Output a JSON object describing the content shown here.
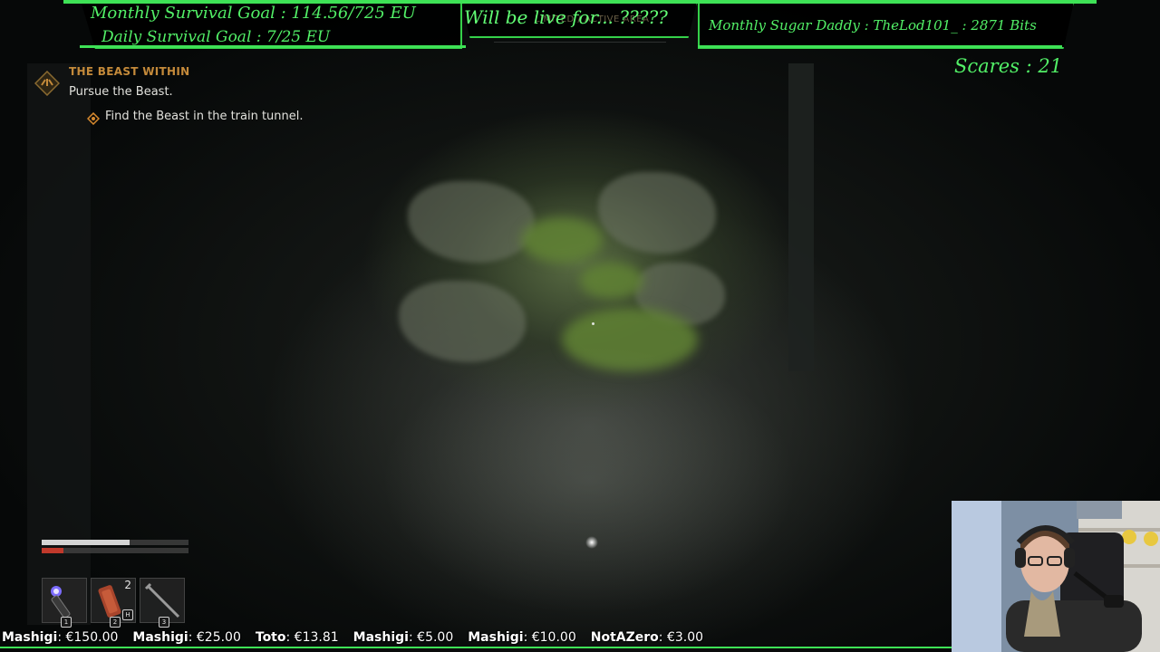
{
  "overlay": {
    "monthly_survival_goal": "Monthly Survival Goal : 114.56/725 EU",
    "daily_survival_goal": "Daily Survival Goal : 7/25 EU",
    "live_for": "Will be live for... ?????",
    "monthly_sugar_daddy": "Monthly Sugar Daddy : TheLod101_ : 2871 Bits",
    "scares": "Scares : 21",
    "partially_hidden_banner": "LIMITED / ACTIVE AREA",
    "accent_color": "#3ee256"
  },
  "quest": {
    "title": "THE BEAST WITHIN",
    "subtitle": "Pursue the Beast.",
    "objective": "Find the Beast in the train tunnel."
  },
  "status": {
    "health_fraction": 0.6,
    "stamina_fraction": 0.15
  },
  "inventory": {
    "slots": [
      {
        "icon": "flashlight-icon",
        "count": "",
        "key": "1"
      },
      {
        "icon": "bandage-icon",
        "count": "2",
        "key": "2"
      },
      {
        "icon": "pipe-weapon-icon",
        "count": "",
        "key": "3"
      }
    ],
    "bandage_hotkey": "H"
  },
  "ticker": {
    "items": [
      {
        "name": "Mashigi",
        "amount": "€150.00"
      },
      {
        "name": "Mashigi",
        "amount": "€25.00"
      },
      {
        "name": "Toto",
        "amount": "€13.81"
      },
      {
        "name": "Mashigi",
        "amount": "€5.00"
      },
      {
        "name": "Mashigi",
        "amount": "€10.00"
      },
      {
        "name": "NotAZero",
        "amount": "€3.00"
      }
    ]
  }
}
